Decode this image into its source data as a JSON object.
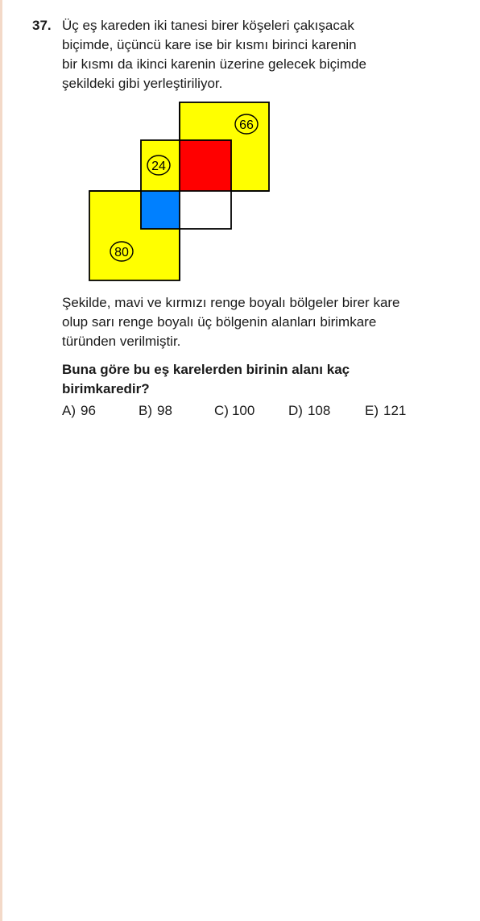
{
  "question": {
    "number": "37.",
    "text_lines": [
      "Üç eş kareden iki tanesi birer köşeleri çakışacak",
      "biçimde, üçüncü kare ise bir kısmı birinci karenin",
      "bir kısmı da ikinci karenin üzerine gelecek biçimde",
      "şekildeki gibi yerleştiriliyor."
    ],
    "description_lines": [
      "Şekilde, mavi ve kırmızı renge boyalı bölgeler birer kare",
      "olup sarı renge boyalı üç bölgenin alanları birimkare",
      "türünden verilmiştir."
    ],
    "prompt_lines": [
      "Buna göre bu eş karelerden birinin alanı kaç",
      "birimkaredir?"
    ]
  },
  "figure": {
    "labels": {
      "top_right_square": "66",
      "middle_square": "24",
      "bottom_left_square": "80"
    },
    "colors": {
      "yellow": "#ffff00",
      "red": "#ff0000",
      "blue": "#0080ff",
      "white": "#ffffff",
      "outline": "#000000"
    }
  },
  "options": [
    {
      "letter": "A)",
      "value": "96"
    },
    {
      "letter": "B)",
      "value": "98"
    },
    {
      "letter": "C)",
      "value": "100"
    },
    {
      "letter": "D)",
      "value": "108"
    },
    {
      "letter": "E)",
      "value": "121"
    }
  ]
}
